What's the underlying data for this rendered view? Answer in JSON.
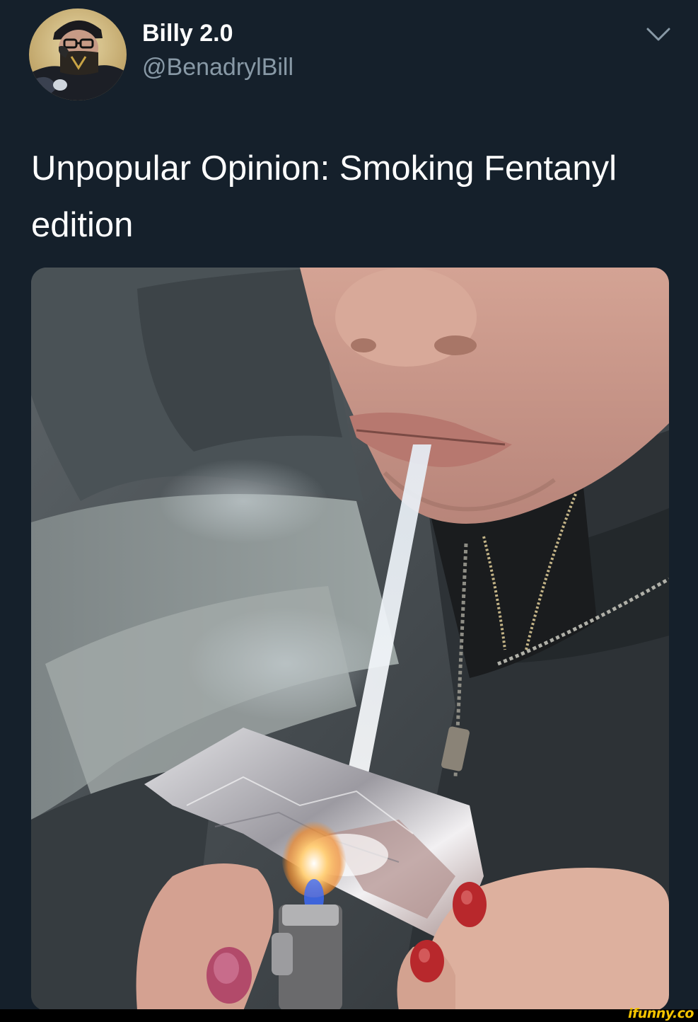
{
  "tweet": {
    "author": {
      "display_name": "Billy 2.0",
      "handle": "@BenadrylBill"
    },
    "text": "Unpopular Opinion: Smoking Fentanyl edition",
    "menu_icon": "chevron-down-icon"
  },
  "watermark": {
    "text": "ifunny.co",
    "color": "#f5c400"
  },
  "colors": {
    "background": "#15202b",
    "primary_text": "#ffffff",
    "secondary_text": "#8899a6"
  }
}
